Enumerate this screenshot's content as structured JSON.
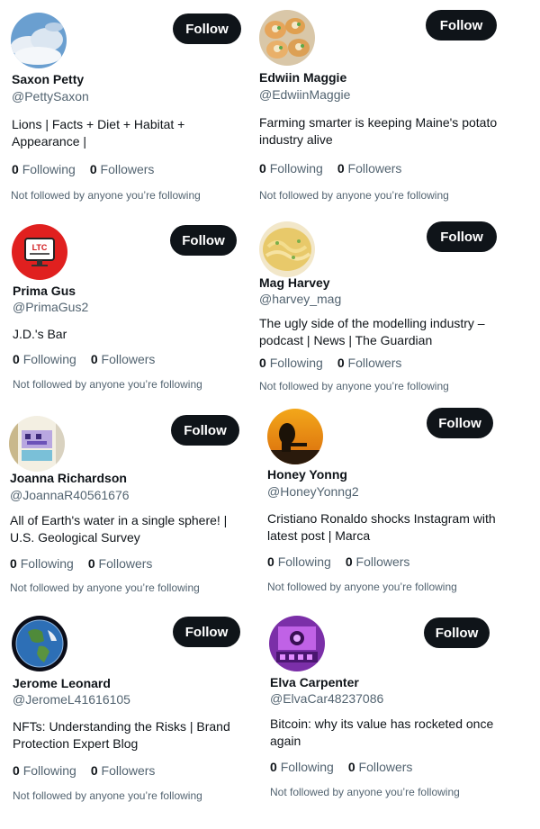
{
  "follow_label": "Follow",
  "following_label": "Following",
  "followers_label": "Followers",
  "note": "Not followed by anyone you’re following",
  "users": [
    {
      "name": "Saxon Petty",
      "handle": "@PettySaxon",
      "bio": "Lions | Facts + Diet + Habitat + Appearance |",
      "following": "0",
      "followers": "0",
      "avatar": "cloudy-sky"
    },
    {
      "name": "Edwiin Maggie",
      "handle": "@EdwiinMaggie",
      "bio": "Farming smarter is keeping Maine's potato industry alive",
      "following": "0",
      "followers": "0",
      "avatar": "stuffed-potatoes"
    },
    {
      "name": "Prima Gus",
      "handle": "@PrimaGus2",
      "bio": "J.D.'s Bar",
      "following": "0",
      "followers": "0",
      "avatar": "ltc-tv-logo"
    },
    {
      "name": "Mag Harvey",
      "handle": "@harvey_mag",
      "bio": "The ugly side of the modelling industry – podcast | News | The Guardian",
      "following": "0",
      "followers": "0",
      "avatar": "pasta-dish"
    },
    {
      "name": "Joanna Richardson",
      "handle": "@JoannaR40561676",
      "bio": "All of Earth's water in a single sphere! | U.S. Geological Survey",
      "following": "0",
      "followers": "0",
      "avatar": "pixel-creature"
    },
    {
      "name": "Honey Yonng",
      "handle": "@HoneyYonng2",
      "bio": "Cristiano Ronaldo shocks Instagram with latest post | Marca",
      "following": "0",
      "followers": "0",
      "avatar": "sunset-silhouette"
    },
    {
      "name": "Jerome Leonard",
      "handle": "@JeromeL41616105",
      "bio": "NFTs: Understanding the Risks | Brand Protection Expert Blog",
      "following": "0",
      "followers": "0",
      "avatar": "earth-globe"
    },
    {
      "name": "Elva Carpenter",
      "handle": "@ElvaCar48237086",
      "bio": "Bitcoin: why its value has rocketed once again",
      "following": "0",
      "followers": "0",
      "avatar": "purple-studio"
    }
  ]
}
